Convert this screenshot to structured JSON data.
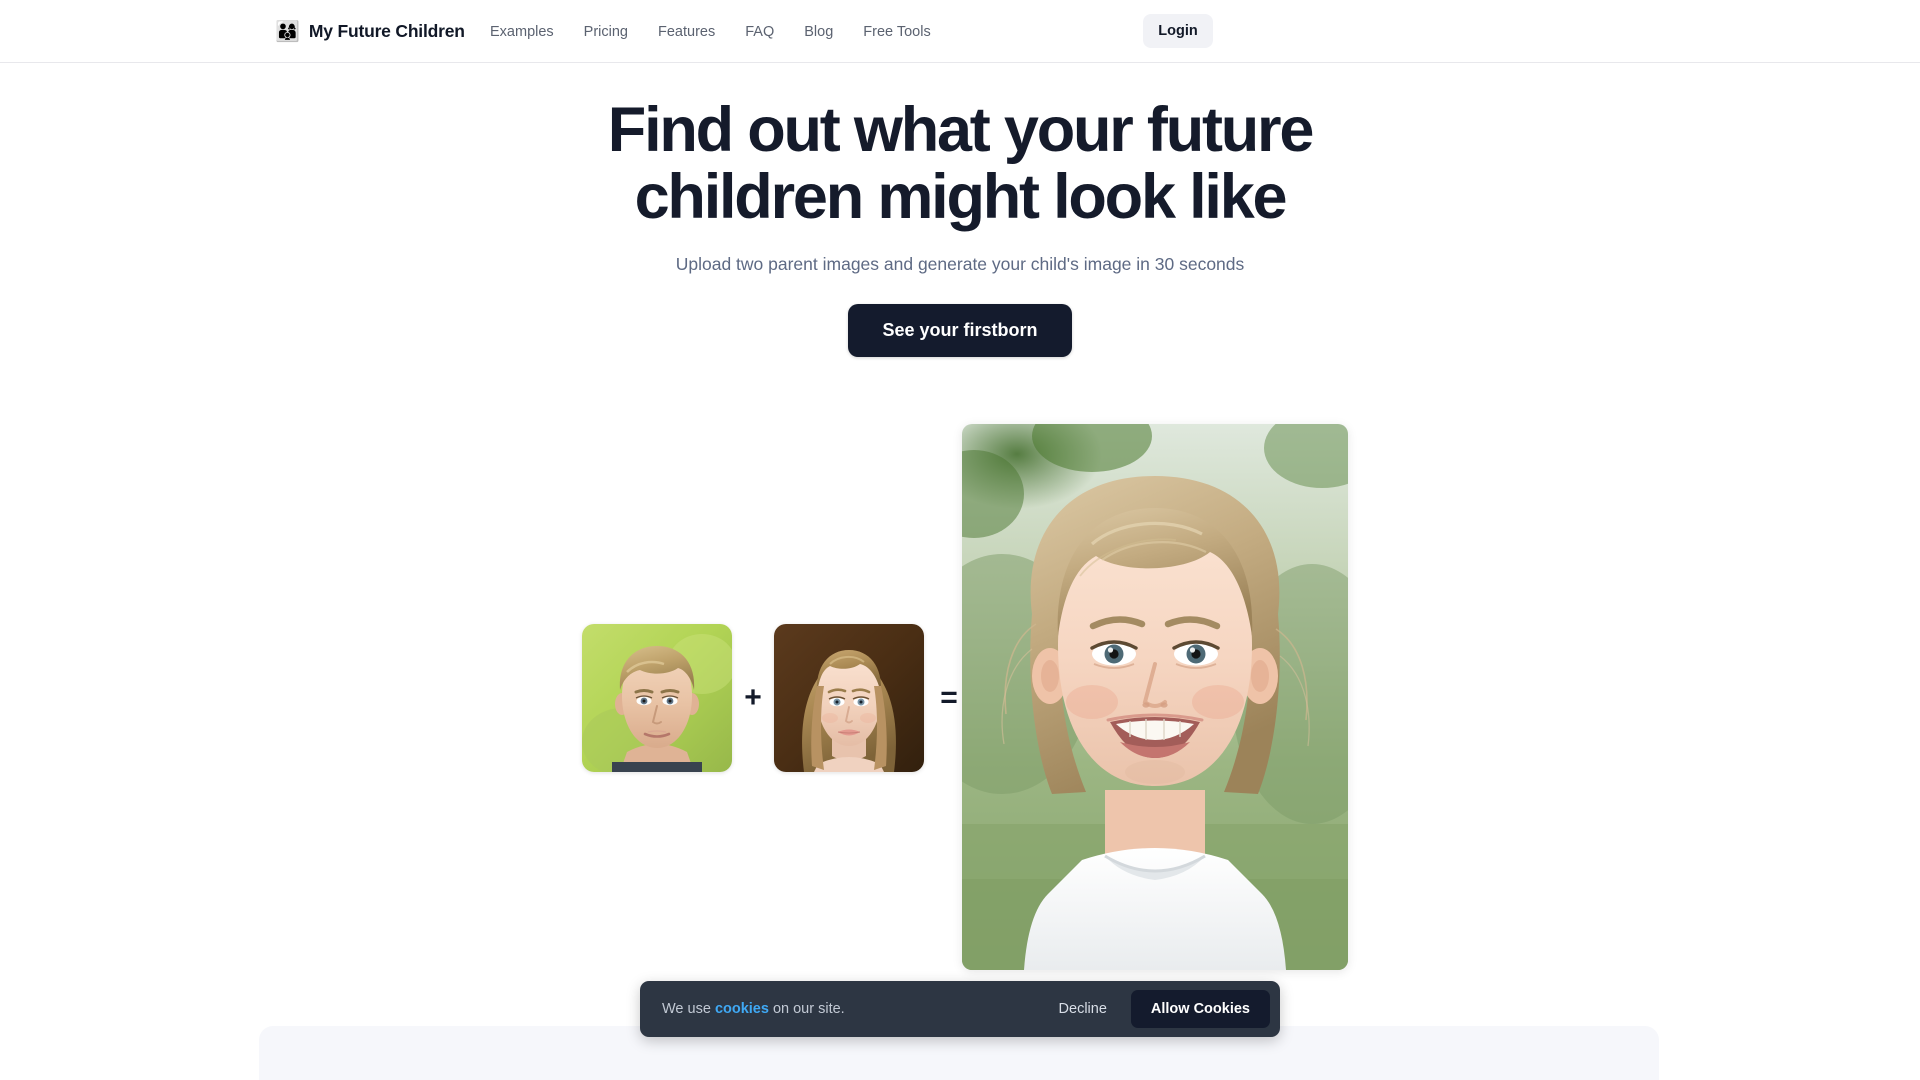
{
  "header": {
    "logo_emoji": "👨‍👩‍👦",
    "brand_name": "My Future Children",
    "nav": [
      {
        "label": "Examples"
      },
      {
        "label": "Pricing"
      },
      {
        "label": "Features"
      },
      {
        "label": "FAQ"
      },
      {
        "label": "Blog"
      },
      {
        "label": "Free Tools"
      }
    ],
    "login_label": "Login"
  },
  "hero": {
    "headline_line1": "Find out what your future",
    "headline_line2": "children might look like",
    "subtitle": "Upload two parent images and generate your child's image in 30 seconds",
    "cta_label": "See your firstborn"
  },
  "composite": {
    "plus_symbol": "+",
    "equals_symbol": "=",
    "parent_one_alt": "Father portrait, blond hair, green outdoor background",
    "parent_two_alt": "Mother portrait, long blonde hair, dark brown background",
    "child_alt": "Smiling young girl with blonde bob haircut in white t-shirt, green park background"
  },
  "cookie_banner": {
    "text_before": "We use ",
    "link_label": "cookies",
    "text_after": " on our site.",
    "decline_label": "Decline",
    "allow_label": "Allow Cookies"
  },
  "colors": {
    "headline": "#151b2b",
    "subtitle": "#5e6a84",
    "cta_bg": "#141b2d",
    "nav_text": "#5b6270",
    "login_bg": "#f1f2f6",
    "cookie_bg": "#2d3643",
    "cookie_link": "#3fa9f5",
    "panel_bg": "#f6f7fb"
  }
}
